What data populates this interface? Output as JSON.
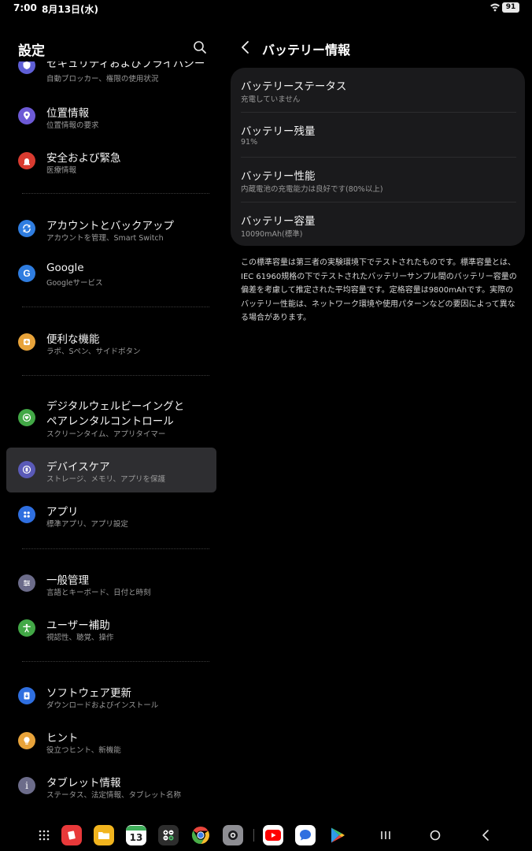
{
  "status": {
    "time": "7:00",
    "date": "8月13日(水)",
    "battery": "91"
  },
  "left": {
    "title": "設定",
    "items": [
      {
        "title": "セキュリティおよびプライバシー",
        "sub": "自動ブロッカー、権限の使用状況",
        "color": "#5f5fd6"
      },
      {
        "title": "位置情報",
        "sub": "位置情報の要求",
        "color": "#6d5ad6"
      },
      {
        "title": "安全および緊急",
        "sub": "医療情報",
        "color": "#d93b30"
      },
      {
        "title": "アカウントとバックアップ",
        "sub": "アカウントを管理、Smart Switch",
        "color": "#2f7de0"
      },
      {
        "title": "Google",
        "sub": "Googleサービス",
        "color": "#2f7de0"
      },
      {
        "title": "便利な機能",
        "sub": "ラボ、Sペン、サイドボタン",
        "color": "#e8a33a"
      },
      {
        "title_line1": "デジタルウェルビーイングと",
        "title_line2": "ペアレンタルコントロール",
        "sub": "スクリーンタイム、アプリタイマー",
        "color": "#42a846"
      },
      {
        "title": "デバイスケア",
        "sub": "ストレージ、メモリ、アプリを保護",
        "color": "#5a5ab8"
      },
      {
        "title": "アプリ",
        "sub": "標準アプリ、アプリ設定",
        "color": "#2f6fe0"
      },
      {
        "title": "一般管理",
        "sub": "言語とキーボード、日付と時刻",
        "color": "#6c6c8a"
      },
      {
        "title": "ユーザー補助",
        "sub": "視認性、聴覚、操作",
        "color": "#42a846"
      },
      {
        "title": "ソフトウェア更新",
        "sub": "ダウンロードおよびインストール",
        "color": "#2f6fe0"
      },
      {
        "title": "ヒント",
        "sub": "役立つヒント、新機能",
        "color": "#e8a33a"
      },
      {
        "title": "タブレット情報",
        "sub": "ステータス、法定情報、タブレット名称",
        "color": "#6c6c8a"
      }
    ]
  },
  "right": {
    "title": "バッテリー情報",
    "rows": [
      {
        "title": "バッテリーステータス",
        "value": "充電していません"
      },
      {
        "title": "バッテリー残量",
        "value": "91%"
      },
      {
        "title": "バッテリー性能",
        "value": "内蔵電池の充電能力は良好です(80%以上)"
      },
      {
        "title": "バッテリー容量",
        "value": "10090mAh(標準)"
      }
    ],
    "note": "この標準容量は第三者の実験環境下でテストされたものです。標準容量とは、IEC 61960規格の下でテストされたバッテリーサンプル間のバッテリー容量の偏差を考慮して推定された平均容量です。定格容量は9800mAhです。実際のバッテリー性能は、ネットワーク環境や使用パターンなどの要因によって異なる場合があります。"
  },
  "taskbar": {
    "calendar_day": "13",
    "apps": [
      "app-drawer-icon",
      "notes-icon",
      "my-files-icon",
      "calendar-icon",
      "calculator-icon",
      "chrome-icon",
      "camera-icon",
      "youtube-icon",
      "messages-icon",
      "play-store-icon"
    ]
  }
}
